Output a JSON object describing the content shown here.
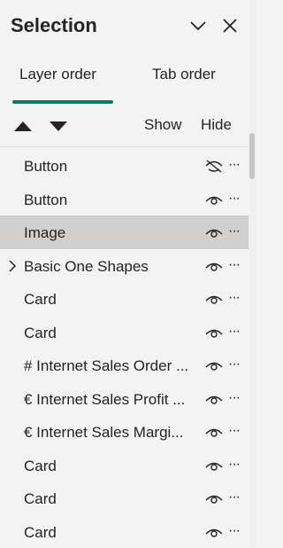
{
  "header": {
    "title": "Selection",
    "collapse_icon": "chevron-down-icon",
    "close_icon": "close-icon"
  },
  "tabs": [
    {
      "label": "Layer order",
      "active": true
    },
    {
      "label": "Tab order",
      "active": false
    }
  ],
  "toolbar": {
    "move_up_icon": "triangle-up-icon",
    "move_down_icon": "triangle-down-icon",
    "show_label": "Show",
    "hide_label": "Hide"
  },
  "layers": [
    {
      "label": "Button",
      "visible": false,
      "selected": false,
      "expandable": false
    },
    {
      "label": "Button",
      "visible": true,
      "selected": false,
      "expandable": false
    },
    {
      "label": "Image",
      "visible": true,
      "selected": true,
      "expandable": false
    },
    {
      "label": "Basic One Shapes",
      "visible": true,
      "selected": false,
      "expandable": true
    },
    {
      "label": "Card",
      "visible": true,
      "selected": false,
      "expandable": false
    },
    {
      "label": "Card",
      "visible": true,
      "selected": false,
      "expandable": false
    },
    {
      "label": "# Internet Sales Order ...",
      "visible": true,
      "selected": false,
      "expandable": false
    },
    {
      "label": "€ Internet Sales Profit ...",
      "visible": true,
      "selected": false,
      "expandable": false
    },
    {
      "label": "€ Internet Sales Margi...",
      "visible": true,
      "selected": false,
      "expandable": false
    },
    {
      "label": "Card",
      "visible": true,
      "selected": false,
      "expandable": false
    },
    {
      "label": "Card",
      "visible": true,
      "selected": false,
      "expandable": false
    },
    {
      "label": "Card",
      "visible": true,
      "selected": false,
      "expandable": false
    }
  ],
  "row_more_label": "···",
  "colors": {
    "accent": "#117865",
    "selected_row": "#d2d0ce",
    "background": "#f3f3f3"
  }
}
